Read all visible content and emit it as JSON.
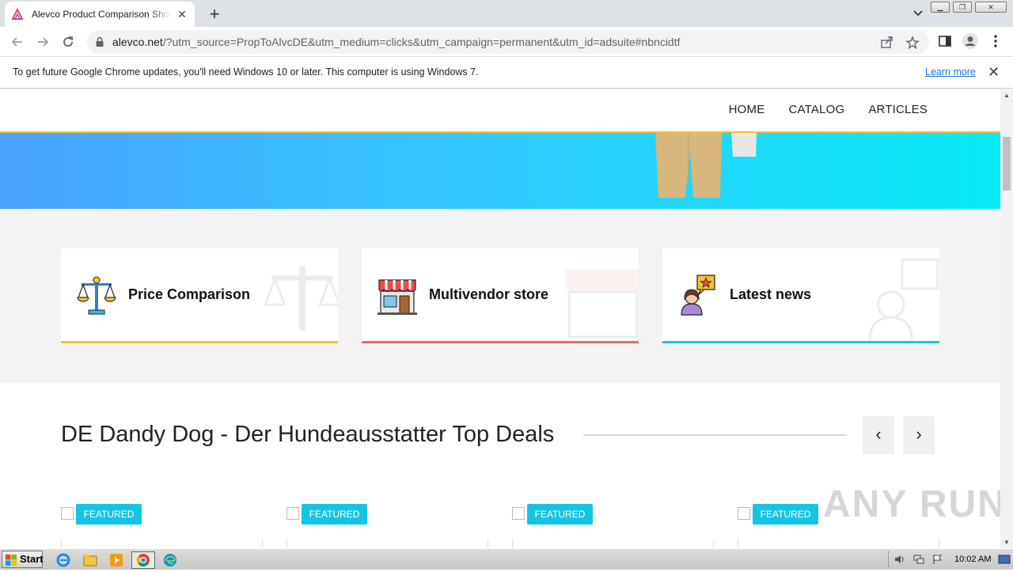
{
  "browser": {
    "tab_title": "Alevco Product Comparison Shopping",
    "new_tab": "+",
    "tab_close": "✕",
    "url_host": "alevco.net",
    "url_rest": "/?utm_source=PropToAlvcDE&utm_medium=clicks&utm_campaign=permanent&utm_id=adsuite#nbncidtf"
  },
  "infobar": {
    "message": "To get future Google Chrome updates, you'll need Windows 10 or later. This computer is using Windows 7.",
    "link": "Learn more",
    "close": "✕"
  },
  "site": {
    "nav": [
      "HOME",
      "CATALOG",
      "ARTICLES"
    ],
    "features": [
      {
        "title": "Price Comparison",
        "accent": "#f2c230",
        "icon": "scales-icon"
      },
      {
        "title": "Multivendor store",
        "accent": "#ef6a6a",
        "icon": "storefront-icon"
      },
      {
        "title": "Latest news",
        "accent": "#14c5e3",
        "icon": "news-person-icon"
      }
    ],
    "deals_title": "DE Dandy Dog - Der Hundeausstatter Top Deals",
    "prev": "‹",
    "next": "›",
    "badge": "FEATURED"
  },
  "watermark": "ANY RUN",
  "taskbar": {
    "start": "Start",
    "clock": "10:02 AM"
  }
}
